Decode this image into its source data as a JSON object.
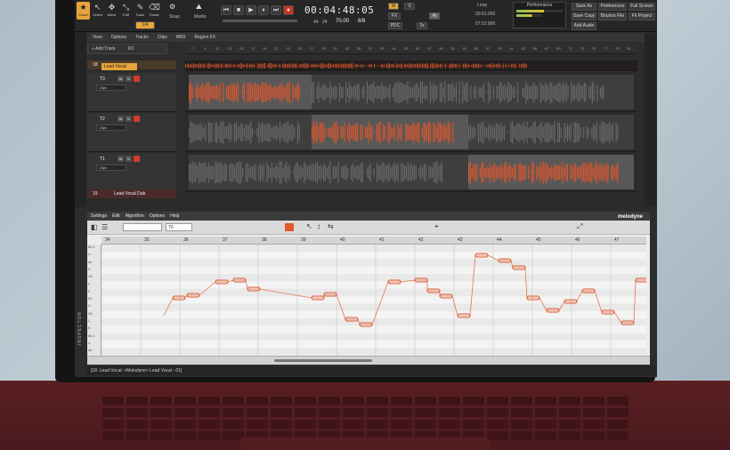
{
  "toolbar": {
    "tools": [
      {
        "label": "Smart",
        "icon": "star-icon",
        "active": true
      },
      {
        "label": "Select",
        "icon": "pointer-icon"
      },
      {
        "label": "Move",
        "icon": "move-icon"
      },
      {
        "label": "Edit",
        "icon": "edit-icon"
      },
      {
        "label": "Draw",
        "icon": "draw-icon"
      },
      {
        "label": "Erase",
        "icon": "erase-icon"
      }
    ],
    "snap_label": "Snap",
    "marks_label": "Marks",
    "snap_value": "1/4",
    "timecode": "00:04:48:05",
    "time_sub_a": "44",
    "time_sub_b": "24",
    "tempo": "70.00",
    "meter": "6/8",
    "loop_label": "Loop",
    "loop_start": "00:01:000",
    "loop_end": "07:01:000",
    "performance_label": "Performance",
    "buttons": [
      "Save As",
      "Preferences",
      "Full Screen",
      "Save Copy",
      "Bounce File",
      "Fit Project",
      "Add Audio"
    ],
    "flags": [
      "M",
      "S",
      "FX",
      "PDC",
      "2x"
    ]
  },
  "track_menu": [
    "View",
    "Options",
    "Tracks",
    "Clips",
    "MIDI",
    "Region FX"
  ],
  "add_track_label": "+ Add Track",
  "add_track_value": "I/O",
  "ruler_ticks": [
    "7",
    "9",
    "11",
    "13",
    "15",
    "17",
    "19",
    "21",
    "23",
    "25",
    "27",
    "29",
    "31",
    "33",
    "35",
    "37",
    "39",
    "41",
    "43",
    "45",
    "47",
    "49",
    "51",
    "53",
    "55",
    "57",
    "59",
    "61",
    "63",
    "65",
    "67",
    "69",
    "71",
    "73",
    "75",
    "77",
    "79",
    "81"
  ],
  "tracks": [
    {
      "num": "18",
      "name": "Lead Vocal"
    },
    {
      "num": "T3",
      "clips": "Clips"
    },
    {
      "num": "T2",
      "clips": "Clips"
    },
    {
      "num": "T1",
      "clips": "Clips"
    },
    {
      "num": "19",
      "name": "Lead Vocal Dub"
    }
  ],
  "melodyne": {
    "menu": [
      "Settings",
      "Edit",
      "Algorithm",
      "Options",
      "Help"
    ],
    "logo": "melodyne",
    "tempo_field": "70",
    "bars": [
      "34",
      "35",
      "36",
      "37",
      "38",
      "39",
      "40",
      "41",
      "42",
      "43",
      "44",
      "45",
      "46",
      "47"
    ],
    "pitches": [
      "Bb 4",
      "A",
      "Ab",
      "G",
      "Gb",
      "F",
      "E",
      "Eb",
      "D",
      "Db",
      "C",
      "B",
      "Bb 3",
      "A",
      "Ab"
    ]
  },
  "inspector_label": "INSPECTOR",
  "status_text": "[18: Lead Vocal: <Melodyne> Lead Vocal - 01]",
  "colors": {
    "accent": "#e7a43a",
    "wave_active": "#e0562a",
    "record": "#d43b2b"
  }
}
